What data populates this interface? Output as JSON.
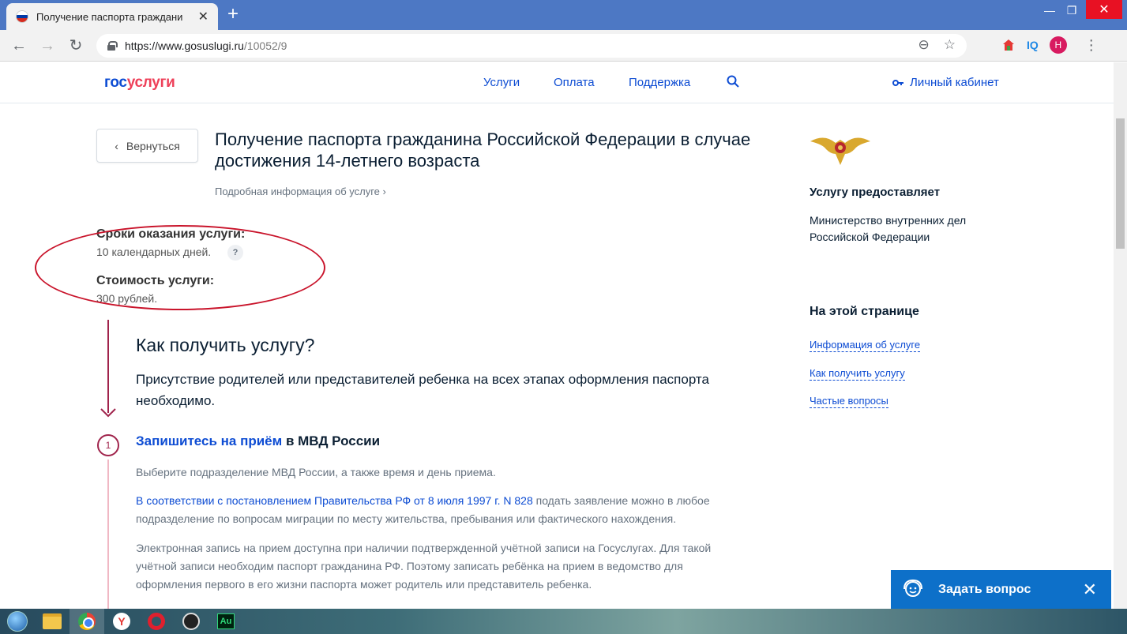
{
  "browser": {
    "tab_title": "Получение паспорта граждани",
    "url_host": "https://www.gosuslugi.ru",
    "url_path": "/10052/9",
    "avatar_letter": "Н",
    "iq_label": "IQ"
  },
  "header": {
    "logo_part1": "гос",
    "logo_part2": "услуги",
    "menu": [
      "Услуги",
      "Оплата",
      "Поддержка"
    ],
    "cabinet": "Личный кабинет"
  },
  "main": {
    "back_label": "Вернуться",
    "title": "Получение паспорта гражданина Российской Федерации в случае достижения 14-летнего возраста",
    "more_info": "Подробная информация об услуге",
    "term_label": "Сроки оказания услуги:",
    "term_value": "10 календарных дней.",
    "help_badge": "?",
    "cost_label": "Стоимость услуги:",
    "cost_value": "300 рублей.",
    "how_title": "Как получить услугу?",
    "how_desc": "Присутствие родителей или представителей ребенка на всех этапах оформления паспорта необходимо.",
    "step_number": "1",
    "step_link": "Запишитесь на приём",
    "step_rest": " в МВД России",
    "p1": "Выберите подразделение МВД России, а также время и день приема.",
    "p2_link": "В соответствии с постановлением Правительства РФ от 8 июля 1997 г. N 828",
    "p2_rest": " подать заявление можно в любое подразделение по вопросам миграции по месту жительства, пребывания или фактического нахождения.",
    "p3": "Электронная запись на прием доступна при наличии подтвержденной учётной записи на Госуслугах. Для такой учётной записи необходим паспорт гражданина РФ. Поэтому записать ребёнка на прием в ведомство для оформления первого в его жизни паспорта может родитель или представитель ребенка."
  },
  "sidebar": {
    "provider_heading": "Услугу предоставляет",
    "provider_name": "Министерство внутренних дел Российской Федерации",
    "on_page_heading": "На этой странице",
    "links": [
      "Информация об услуге",
      "Как получить услугу",
      "Частые вопросы"
    ]
  },
  "chat": {
    "label": "Задать вопрос"
  },
  "colors": {
    "brand_blue": "#0d4cd3",
    "brand_red": "#ee3f58",
    "annotation_red": "#c9142b",
    "timeline": "#a0244c",
    "chat_bg": "#0d70c9"
  }
}
